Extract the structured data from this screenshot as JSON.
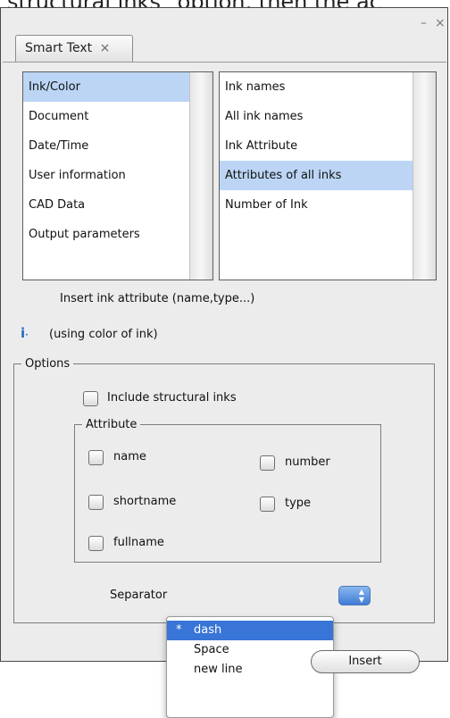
{
  "caption": "structural inks\" option, then the ac",
  "window": {
    "minimize_glyph": "–",
    "close_glyph": "×"
  },
  "tab": {
    "label": "Smart Text",
    "close_glyph": "×"
  },
  "categories": {
    "selected_index": 0,
    "items": [
      "Ink/Color",
      "Document",
      "Date/Time",
      "User information",
      "CAD Data",
      "Output parameters"
    ]
  },
  "fields": {
    "selected_index": 3,
    "items": [
      "Ink names",
      "All ink names",
      "Ink Attribute",
      "Attributes of all inks",
      "Number of Ink"
    ]
  },
  "description": "Insert ink attribute (name,type...)",
  "info": {
    "icon": "info-icon",
    "glyph": "i",
    "text": "(using color of ink)"
  },
  "options": {
    "legend": "Options",
    "include_structural": {
      "label": "Include structural inks",
      "checked": false
    },
    "attribute": {
      "legend": "Attribute",
      "name": {
        "label": "name",
        "checked": false
      },
      "number": {
        "label": "number",
        "checked": false
      },
      "shortname": {
        "label": "shortname",
        "checked": false
      },
      "type": {
        "label": "type",
        "checked": false
      },
      "fullname": {
        "label": "fullname",
        "checked": false
      }
    },
    "separator": {
      "label": "Separator",
      "selected": "dash",
      "check_glyph": "*",
      "options": [
        "dash",
        "Space",
        "new line"
      ]
    }
  },
  "insert_button": "Insert",
  "colors": {
    "selection": "#bcd5f5",
    "menu_highlight": "#3875d7",
    "info_icon": "#2a6bc4"
  }
}
